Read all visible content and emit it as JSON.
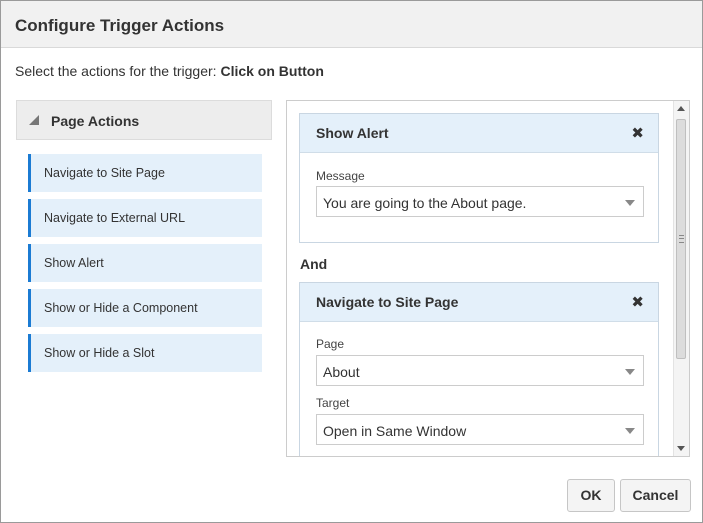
{
  "dialog": {
    "title": "Configure Trigger Actions",
    "subtitle_prefix": "Select the actions for the trigger: ",
    "subtitle_trigger": "Click on Button"
  },
  "left_panel": {
    "header": "Page Actions",
    "items": [
      {
        "label": "Navigate to Site Page"
      },
      {
        "label": "Navigate to External URL"
      },
      {
        "label": "Show Alert"
      },
      {
        "label": "Show or Hide a Component"
      },
      {
        "label": "Show or Hide a Slot"
      }
    ]
  },
  "actions": {
    "show_alert": {
      "title": "Show Alert",
      "close": "✖",
      "message_label": "Message",
      "message_value": "You are going to the About page."
    },
    "connector": "And",
    "navigate": {
      "title": "Navigate to Site Page",
      "close": "✖",
      "page_label": "Page",
      "page_value": "About",
      "target_label": "Target",
      "target_value": "Open in Same Window"
    }
  },
  "footer": {
    "ok_label": "OK",
    "cancel_label": "Cancel"
  }
}
